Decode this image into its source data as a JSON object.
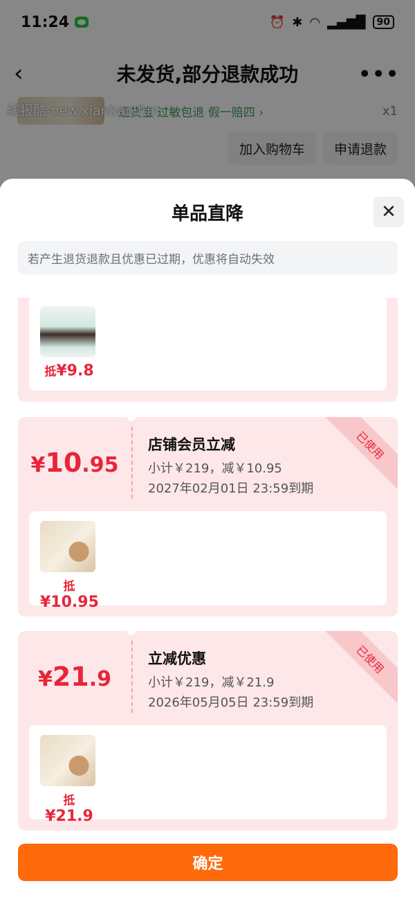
{
  "status": {
    "time": "11:24",
    "battery": "90",
    "icons": [
      "wechat-icon",
      "alarm-icon",
      "bluetooth-icon",
      "wifi-icon",
      "signal-icon"
    ]
  },
  "header": {
    "title": "未发货,部分退款成功"
  },
  "order": {
    "tags": "退货宝  过敏包退  假一赔四 ›",
    "qty": "x1"
  },
  "watermark": "线报酷-new.xianbao.fun",
  "buttons": {
    "add_cart": "加入购物车",
    "refund": "申请退款"
  },
  "sheet": {
    "title": "单品直降",
    "notice": "若产生退货退款且优惠已过期，优惠将自动失效",
    "confirm": "确定"
  },
  "cards": [
    {
      "deduct_label": "抵",
      "deduct_value": "¥9.8"
    },
    {
      "amount_cur": "¥",
      "amount_int": "10",
      "amount_dec": ".95",
      "title": "店铺会员立减",
      "line1": "小计￥219，减￥10.95",
      "line2": "2027年02月01日 23:59到期",
      "badge": "已使用",
      "deduct_label": "抵",
      "deduct_value": "¥10.95"
    },
    {
      "amount_cur": "¥",
      "amount_int": "21",
      "amount_dec": ".9",
      "title": "立减优惠",
      "line1": "小计￥219，减￥21.9",
      "line2": "2026年05月05日 23:59到期",
      "badge": "已使用",
      "deduct_label": "抵",
      "deduct_value": "¥21.9"
    }
  ],
  "colors": {
    "accent": "#ff6a0c",
    "price": "#e8253a",
    "card_bg": "#fde7e8"
  }
}
